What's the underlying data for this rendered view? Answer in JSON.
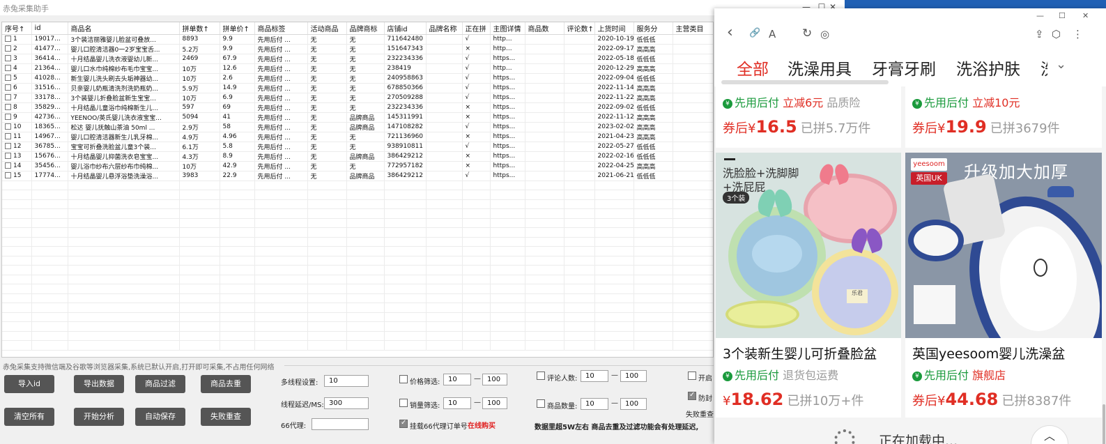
{
  "app": {
    "title": "赤兔采集助手",
    "min": "—",
    "max": "☐",
    "close": "✕"
  },
  "table": {
    "headers": [
      "序号↑",
      "id",
      "商品名",
      "拼单数↑",
      "拼单价↑",
      "商品标签",
      "活动商品",
      "品牌商标",
      "店铺id",
      "品牌名称",
      "正在拼",
      "主图详情",
      "商品数",
      "评论数↑",
      "上货时间",
      "服务分",
      "主营类目"
    ],
    "rows": [
      [
        "1",
        "19017...",
        "3个装洁丽雅婴儿脸盆可叠放...",
        "8893",
        "9.9",
        "先用后付 ...",
        "无",
        "无",
        "711642480",
        "",
        "√",
        "http...",
        "",
        "",
        "2020-10-19",
        "低低低",
        ""
      ],
      [
        "2",
        "41477...",
        "婴儿口腔清洁器0一2岁宝宝舌...",
        "5.2万",
        "9.9",
        "先用后付 ...",
        "无",
        "无",
        "151647343",
        "",
        "×",
        "http...",
        "",
        "",
        "2022-09-17",
        "高高高",
        ""
      ],
      [
        "3",
        "36414...",
        "十月结晶婴儿洗衣液婴幼儿新...",
        "2469",
        "67.9",
        "先用后付 ...",
        "无",
        "无",
        "232234336",
        "",
        "√",
        "https...",
        "",
        "",
        "2022-05-18",
        "低低低",
        ""
      ],
      [
        "4",
        "21364...",
        "婴儿口水巾纯棉纱布毛巾宝宝...",
        "10万",
        "12.6",
        "先用后付 ...",
        "无",
        "无",
        "238419",
        "",
        "√",
        "http...",
        "",
        "",
        "2020-12-29",
        "高高高",
        ""
      ],
      [
        "5",
        "41028...",
        "新生婴儿洗头刷去头垢神器幼...",
        "10万",
        "2.6",
        "先用后付 ...",
        "无",
        "无",
        "240958863",
        "",
        "√",
        "https...",
        "",
        "",
        "2022-09-04",
        "低低低",
        ""
      ],
      [
        "6",
        "31516...",
        "贝亲婴儿奶瓶清洗剂洗奶瓶奶...",
        "5.9万",
        "14.9",
        "先用后付 ...",
        "无",
        "无",
        "678850366",
        "",
        "√",
        "https...",
        "",
        "",
        "2022-11-14",
        "高高高",
        ""
      ],
      [
        "7",
        "33178...",
        "3个装婴儿折叠脸盆新生宝宝...",
        "10万",
        "6.9",
        "先用后付 ...",
        "无",
        "无",
        "270509288",
        "",
        "√",
        "https...",
        "",
        "",
        "2022-11-22",
        "高高高",
        ""
      ],
      [
        "8",
        "35829...",
        "十月结晶儿童浴巾纯棉新生儿...",
        "597",
        "69",
        "先用后付 ...",
        "无",
        "无",
        "232234336",
        "",
        "×",
        "https...",
        "",
        "",
        "2022-09-02",
        "低低低",
        ""
      ],
      [
        "9",
        "42736...",
        "YEENOO/英氏婴儿洗衣液宝宝...",
        "5094",
        "41",
        "先用后付 ...",
        "无",
        "品牌商品",
        "145311991",
        "",
        "×",
        "https...",
        "",
        "",
        "2022-11-12",
        "高高高",
        ""
      ],
      [
        "10",
        "18365...",
        "松达 婴儿抚触山茶油 50ml ...",
        "2.9万",
        "58",
        "先用后付 ...",
        "无",
        "品牌商品",
        "147108282",
        "",
        "√",
        "https...",
        "",
        "",
        "2023-02-02",
        "高高高",
        ""
      ],
      [
        "11",
        "14967...",
        "婴儿口腔清洁器新生儿乳牙棉...",
        "4.9万",
        "4.96",
        "先用后付 ...",
        "无",
        "无",
        "721136960",
        "",
        "×",
        "https...",
        "",
        "",
        "2021-04-23",
        "高高高",
        ""
      ],
      [
        "12",
        "36785...",
        "宝宝可折叠洗脸盆儿童3个装...",
        "6.1万",
        "5.8",
        "先用后付 ...",
        "无",
        "无",
        "938910811",
        "",
        "√",
        "https...",
        "",
        "",
        "2022-05-27",
        "低低低",
        ""
      ],
      [
        "13",
        "15676...",
        "十月结晶婴儿抑菌洗衣皂宝宝...",
        "4.3万",
        "8.9",
        "先用后付 ...",
        "无",
        "品牌商品",
        "386429212",
        "",
        "×",
        "https...",
        "",
        "",
        "2022-02-16",
        "低低低",
        ""
      ],
      [
        "14",
        "35456...",
        "婴儿浴巾纱布六层纱布巾纯棉...",
        "10万",
        "42.9",
        "先用后付 ...",
        "无",
        "无",
        "772957182",
        "",
        "×",
        "https...",
        "",
        "",
        "2022-04-25",
        "高高高",
        ""
      ],
      [
        "15",
        "17774...",
        "十月结晶婴儿悬浮浴垫洗澡浴...",
        "3983",
        "22.9",
        "先用后付 ...",
        "无",
        "品牌商品",
        "386429212",
        "",
        "√",
        "https...",
        "",
        "",
        "2021-06-21",
        "低低低",
        ""
      ]
    ]
  },
  "tip": "赤兔采集支持微信端及谷歌等浏览器采集,系统已默认开启,打开即可采集,不占用任何网络",
  "buttons": {
    "import_id": "导入id",
    "export": "导出数据",
    "filter": "商品过滤",
    "dedupe": "商品去重",
    "clear": "清空所有",
    "start": "开始分析",
    "autosave": "自动保存",
    "retry": "失败重查"
  },
  "settings": {
    "threads_label": "多线程设置:",
    "threads_value": "10",
    "delay_label": "线程延迟/MS:",
    "delay_value": "300",
    "proxy_label": "66代理:",
    "proxy_value": "",
    "price_label": "价格筛选:",
    "price_min": "10",
    "price_max": "100",
    "sales_label": "销量筛选:",
    "sales_min": "10",
    "sales_max": "100",
    "hang_label": "挂载66代理订单号",
    "buy_online": "在线购买",
    "reviews_label": "评论人数:",
    "reviews_min": "10",
    "reviews_max": "100",
    "count_label": "商品数量:",
    "count_min": "10",
    "count_max": "100",
    "notice": "数据里超5W左右  商品去重及过滤功能会有处理延迟,",
    "open_label": "开启",
    "anti_label": "防封",
    "fail_label": "失败重查",
    "dash": "—"
  },
  "browser": {
    "ctrl_min": "—",
    "ctrl_max": "☐",
    "ctrl_close": "✕",
    "icons": {
      "back": "‹",
      "link": "🔗",
      "font": "A",
      "refresh": "↻",
      "compass": "◎",
      "share": "⇪",
      "cube": "⬡",
      "more": "⋮"
    },
    "categories": [
      "全部",
      "洗澡用具",
      "牙膏牙刷",
      "洗浴护肤",
      "洗"
    ],
    "chevron": "⌄",
    "cards": [
      {
        "tag1": "先用后付",
        "tag2": "立减6元",
        "tag3": "品质险",
        "price_prefix": "券后¥",
        "price": "16.5",
        "sold": "已拼5.7万件"
      },
      {
        "tag1": "先用后付",
        "tag2": "立减10元",
        "price_prefix": "券后¥",
        "price": "19.9",
        "sold": "已拼3679件"
      },
      {
        "img_text1": "洗脸脸+洗脚脚",
        "img_text2": "+洗屁屁",
        "img_badge": "3个装",
        "pot_label": "乐君",
        "title": "3个装新生婴儿可折叠脸盆",
        "tag1": "先用后付",
        "tag2": "退货包运费",
        "price_prefix": "¥",
        "price": "18.62",
        "sold": "已拼10万+件"
      },
      {
        "img_brand": "yeesoom",
        "img_country": "英国UK",
        "img_slogan": "升级加大加厚",
        "title": "英国yeesoom婴儿洗澡盆",
        "tag1": "先用后付",
        "tag2": "旗舰店",
        "price_prefix": "券后¥",
        "price": "44.68",
        "sold": "已拼8387件"
      }
    ],
    "top_btn": "顶部",
    "loading": "正在加载中..."
  }
}
